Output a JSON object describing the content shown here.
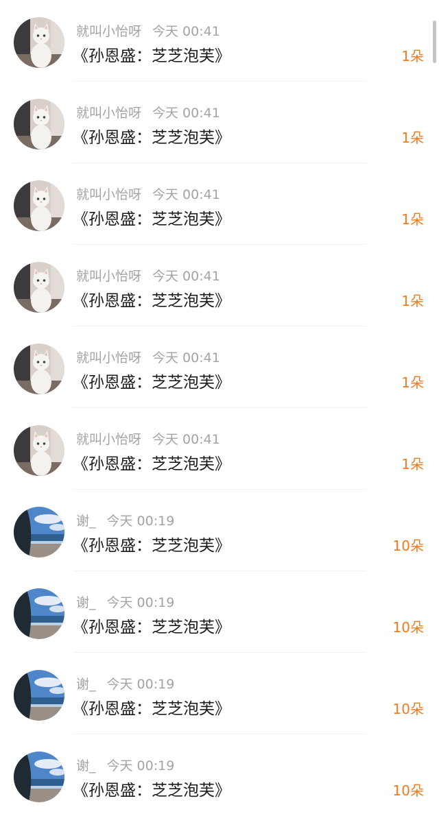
{
  "accent_color": "#f07a1e",
  "comments": [
    {
      "user": "就叫小怡呀",
      "time": "今天 00:41",
      "message": "《孙恩盛：芝芝泡芙》",
      "count": "1朵",
      "avatar": "white-cat-avatar"
    },
    {
      "user": "就叫小怡呀",
      "time": "今天 00:41",
      "message": "《孙恩盛：芝芝泡芙》",
      "count": "1朵",
      "avatar": "white-cat-avatar"
    },
    {
      "user": "就叫小怡呀",
      "time": "今天 00:41",
      "message": "《孙恩盛：芝芝泡芙》",
      "count": "1朵",
      "avatar": "white-cat-avatar"
    },
    {
      "user": "就叫小怡呀",
      "time": "今天 00:41",
      "message": "《孙恩盛：芝芝泡芙》",
      "count": "1朵",
      "avatar": "white-cat-avatar"
    },
    {
      "user": "就叫小怡呀",
      "time": "今天 00:41",
      "message": "《孙恩盛：芝芝泡芙》",
      "count": "1朵",
      "avatar": "white-cat-avatar"
    },
    {
      "user": "就叫小怡呀",
      "time": "今天 00:41",
      "message": "《孙恩盛：芝芝泡芙》",
      "count": "1朵",
      "avatar": "white-cat-avatar"
    },
    {
      "user": "谢_",
      "time": "今天 00:19",
      "message": "《孙恩盛：芝芝泡芙》",
      "count": "10朵",
      "avatar": "seaside-avatar"
    },
    {
      "user": "谢_",
      "time": "今天 00:19",
      "message": "《孙恩盛：芝芝泡芙》",
      "count": "10朵",
      "avatar": "seaside-avatar"
    },
    {
      "user": "谢_",
      "time": "今天 00:19",
      "message": "《孙恩盛：芝芝泡芙》",
      "count": "10朵",
      "avatar": "seaside-avatar"
    },
    {
      "user": "谢_",
      "time": "今天 00:19",
      "message": "《孙恩盛：芝芝泡芙》",
      "count": "10朵",
      "avatar": "seaside-avatar"
    }
  ]
}
